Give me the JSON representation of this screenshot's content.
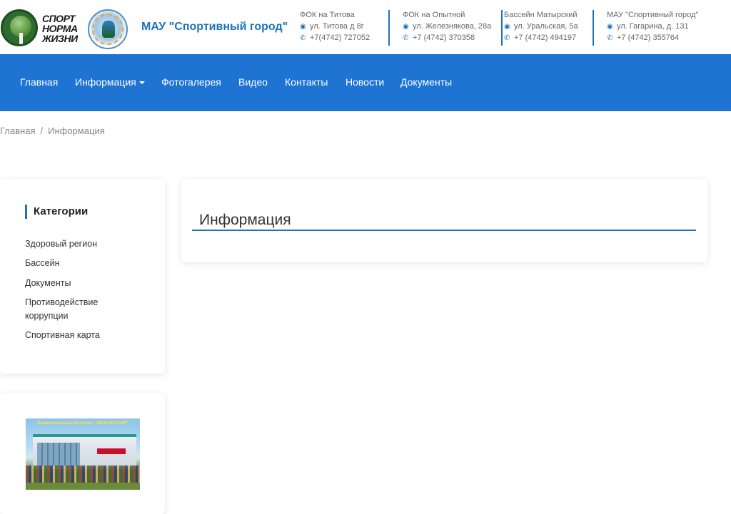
{
  "header": {
    "logo_text": [
      "СПОРТ",
      "НОРМА",
      "ЖИЗНИ"
    ],
    "org_title": "МАУ \"Спортивный город\"",
    "contacts": [
      {
        "name": "ФОК на Титова",
        "address": "ул. Титова д 8г",
        "phone": "+7(4742) 727052"
      },
      {
        "name": "ФОК на Опытной",
        "address": "ул. Железнякова, 28а",
        "phone": "+7 (4742) 370358"
      },
      {
        "name": "Бассейн Матырский",
        "address": "ул. Уральская, 5а",
        "phone": "+7 (4742) 494197"
      },
      {
        "name": "МАУ \"Спортивный город\"",
        "address": "ул. Гагарина, д. 131",
        "phone": "+7 (4742) 355764"
      }
    ]
  },
  "nav": {
    "items": [
      "Главная",
      "Информация",
      "Фотогалерея",
      "Видео",
      "Контакты",
      "Новости",
      "Документы"
    ]
  },
  "breadcrumb": {
    "home": "Главная",
    "current": "Информация"
  },
  "sidebar": {
    "title": "Категории",
    "items": [
      "Здоровый регион",
      "Бассейн",
      "Документы",
      "Противодействие коррупции",
      "Спортивная карта"
    ],
    "banner_caption": "Плавательный бассейн \"МАТЫРСКИЙ\""
  },
  "main": {
    "title": "Информация"
  },
  "colors": {
    "brand_blue": "#1e73d3",
    "accent": "#1e73be"
  }
}
